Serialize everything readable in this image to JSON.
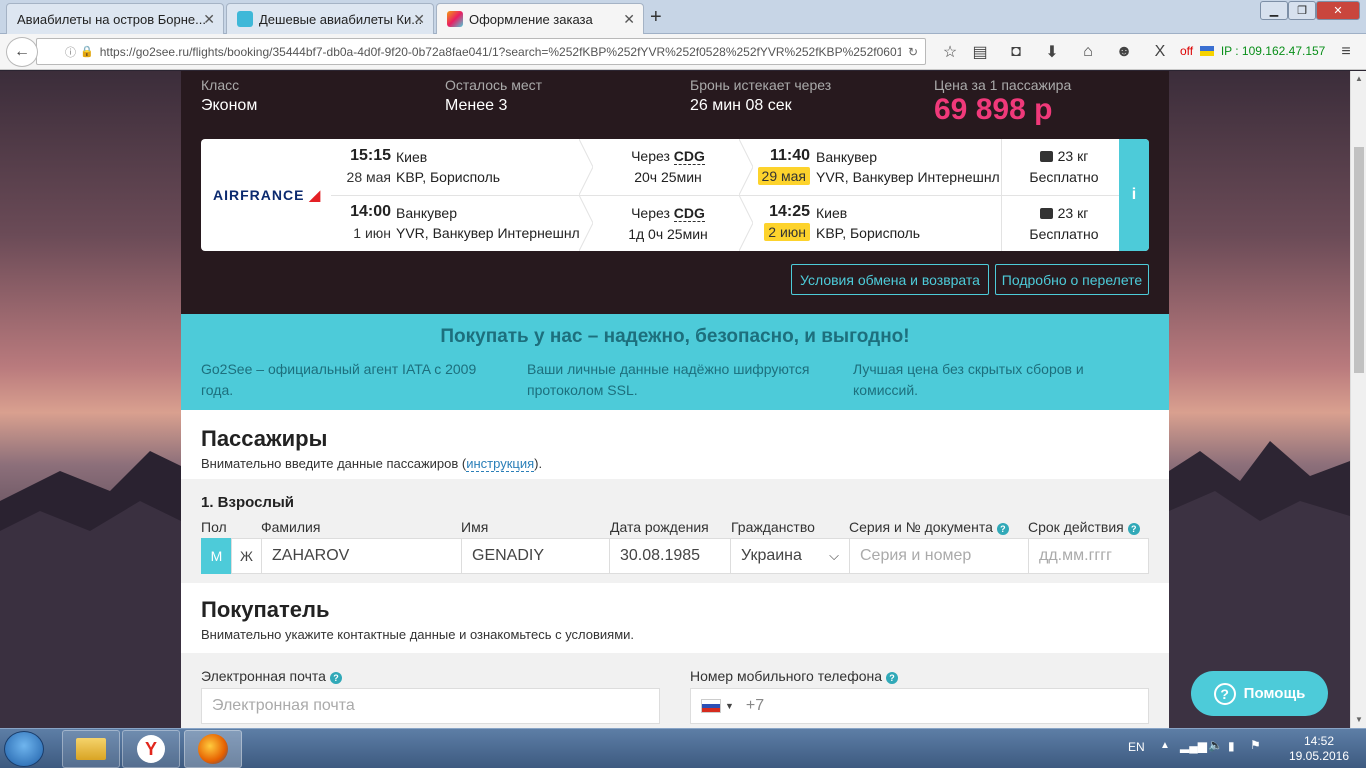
{
  "browser": {
    "tabs": [
      {
        "title": "Авиабилеты на остров Борне..."
      },
      {
        "title": "Дешевые авиабилеты Ки..."
      },
      {
        "title": "Оформление заказа"
      }
    ],
    "url": "https://go2see.ru/flights/booking/35444bf7-db0a-4d0f-9f20-0b72a8fae041/1?search=%252fKBP%252fYVR%252f0528%252fYVR%252fKBP%252f0601?",
    "off_label": "off",
    "ip": "IP : 109.162.47.157"
  },
  "summary": {
    "class_label": "Класс",
    "class_value": "Эконом",
    "seats_label": "Осталось мест",
    "seats_value": "Менее 3",
    "expires_label": "Бронь истекает через",
    "expires_value": "26 мин 08 сек",
    "price_label": "Цена за 1 пассажира",
    "price_value": "69 898 р"
  },
  "flight": {
    "airline": "AIRFRANCE",
    "legs": [
      {
        "dep_time": "15:15",
        "dep_date": "28 мая",
        "dep_city": "Киев",
        "dep_airport": "KBP, Борисполь",
        "via_label": "Через",
        "via_code": "CDG",
        "duration": "20ч 25мин",
        "arr_time": "11:40",
        "arr_date": "29 мая",
        "arr_city": "Ванкувер",
        "arr_airport": "YVR, Ванкувер Интернешнл",
        "baggage": "23 кг",
        "fee": "Бесплатно"
      },
      {
        "dep_time": "14:00",
        "dep_date": "1 июн",
        "dep_city": "Ванкувер",
        "dep_airport": "YVR, Ванкувер Интернешнл",
        "via_label": "Через",
        "via_code": "CDG",
        "duration": "1д 0ч 25мин",
        "arr_time": "14:25",
        "arr_date": "2 июн",
        "arr_city": "Киев",
        "arr_airport": "KBP, Борисполь",
        "baggage": "23 кг",
        "fee": "Бесплатно"
      }
    ],
    "info_icon": "i",
    "exchange_button": "Условия обмена и возврата",
    "details_button": "Подробно о перелете"
  },
  "promo": {
    "title": "Покупать у нас – надежно, безопасно, и выгодно!",
    "points": [
      "Go2See – официальный агент IATA с 2009 года.",
      "Ваши личные данные надёжно шифруются протоколом SSL.",
      "Лучшая цена без скрытых сборов и комиссий."
    ]
  },
  "passengers": {
    "title": "Пассажиры",
    "subtitle_before": "Внимательно введите данные пассажиров (",
    "subtitle_link": "инструкция",
    "subtitle_after": ").",
    "passenger_title": "1. Взрослый",
    "labels": {
      "gender": "Пол",
      "surname": "Фамилия",
      "name": "Имя",
      "birth": "Дата рождения",
      "citizenship": "Гражданство",
      "document": "Серия и № документа",
      "expiry": "Срок действия"
    },
    "gender_m": "М",
    "gender_f": "Ж",
    "surname": "ZAHAROV",
    "name": "GENADIY",
    "birth": "30.08.1985",
    "citizenship": "Украина",
    "document_placeholder": "Серия и номер",
    "expiry_placeholder": "дд.мм.гггг"
  },
  "buyer": {
    "title": "Покупатель",
    "subtitle": "Внимательно укажите контактные данные и ознакомьтесь с условиями.",
    "email_label": "Электронная почта",
    "email_placeholder": "Электронная почта",
    "phone_label": "Номер мобильного телефона",
    "phone_prefix": "+7"
  },
  "help_button": "Помощь",
  "taskbar": {
    "lang": "EN",
    "time": "14:52",
    "date": "19.05.2016"
  },
  "colors": {
    "accent": "#4dcbd9",
    "price": "#f0397a",
    "highlight": "#fdd32c",
    "dark": "#27191e"
  }
}
